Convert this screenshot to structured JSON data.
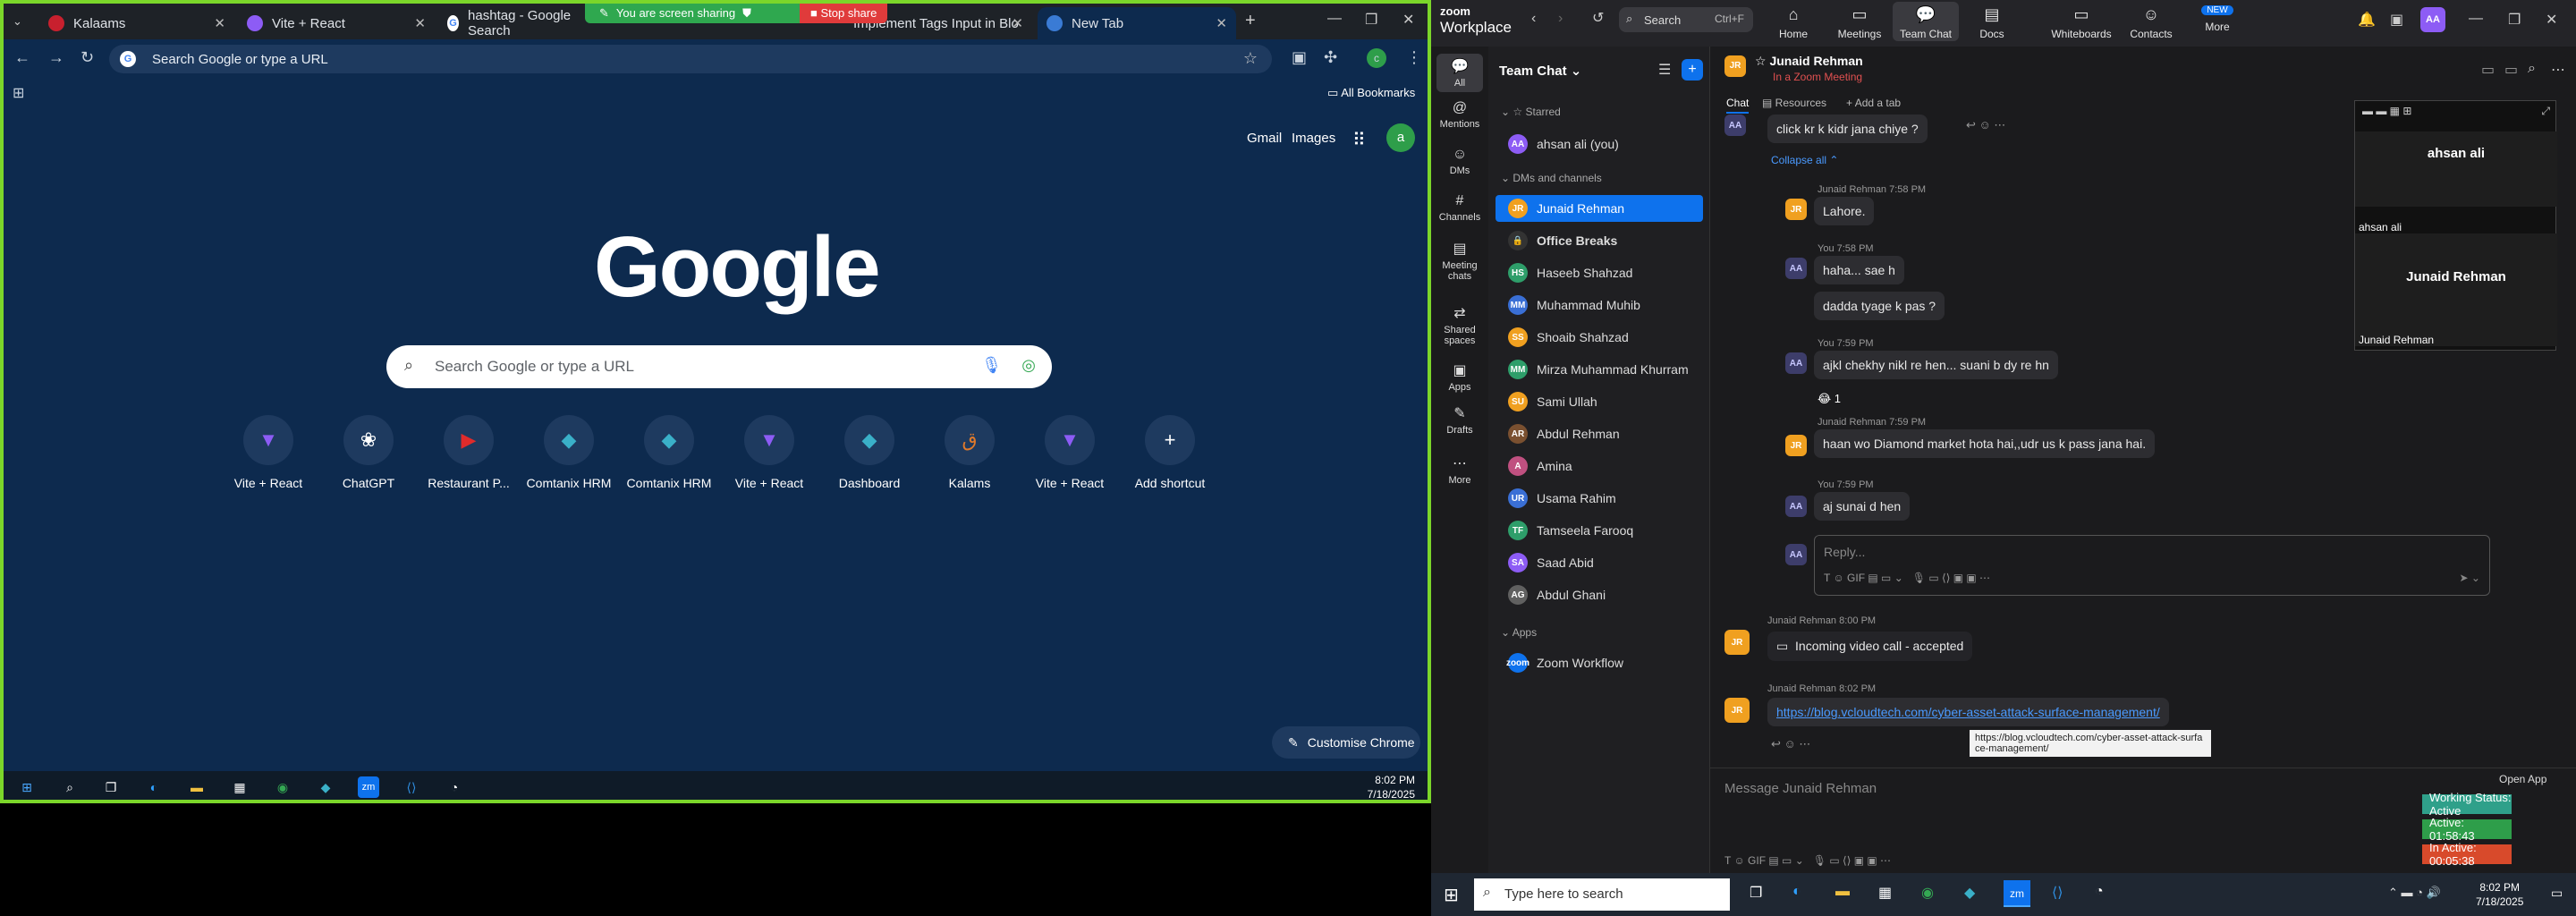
{
  "browser": {
    "tabs": [
      {
        "title": "Kalaams",
        "color": "#c8202e"
      },
      {
        "title": "Vite + React",
        "color": "#8d5cf5"
      },
      {
        "title": "hashtag - Google Search",
        "color": "#ffffff"
      },
      {
        "title": "Implement Tags Input in Blo",
        "color": "#3ad6a6"
      },
      {
        "title": "New Tab",
        "color": "#3a7bd5"
      }
    ],
    "share_banner": {
      "sharing": "You are screen sharing",
      "stop": "Stop share"
    },
    "omnibox": "Search Google or type a URL",
    "all_bookmarks": "All Bookmarks",
    "top_links": {
      "gmail": "Gmail",
      "images": "Images",
      "avatar": "a"
    },
    "logo": "Google",
    "search_placeholder": "Search Google or type a URL",
    "shortcuts": [
      {
        "label": "Vite + React",
        "icon": "▼",
        "color": "#8d5cf5"
      },
      {
        "label": "ChatGPT",
        "icon": "❀",
        "color": "#ffffff"
      },
      {
        "label": "Restaurant P...",
        "icon": "▶",
        "color": "#e02b2b"
      },
      {
        "label": "Comtanix HRM",
        "icon": "◆",
        "color": "#3ab0c8"
      },
      {
        "label": "Comtanix HRM",
        "icon": "◆",
        "color": "#3ab0c8"
      },
      {
        "label": "Vite + React",
        "icon": "▼",
        "color": "#8d5cf5"
      },
      {
        "label": "Dashboard",
        "icon": "◆",
        "color": "#3ab0c8"
      },
      {
        "label": "Kalams",
        "icon": "ق",
        "color": "#e07a2b"
      },
      {
        "label": "Vite + React",
        "icon": "▼",
        "color": "#8d5cf5"
      },
      {
        "label": "Add shortcut",
        "icon": "+",
        "color": "#ffffff"
      }
    ],
    "customise": "Customise Chrome",
    "time": "8:02 PM",
    "date": "7/18/2025"
  },
  "zoom": {
    "brand_top": "zoom",
    "brand_bottom": "Workplace",
    "search": "Search",
    "search_shortcut": "Ctrl+F",
    "nav": [
      "Home",
      "Meetings",
      "Team Chat",
      "Docs",
      "Whiteboards",
      "Contacts",
      "More"
    ],
    "new_badge": "NEW",
    "user_initials": "AA",
    "rail": [
      "All",
      "Mentions",
      "DMs",
      "Channels",
      "Meeting chats",
      "Shared spaces",
      "Apps",
      "Drafts",
      "More"
    ],
    "list_title": "Team Chat",
    "sections": {
      "starred": "Starred",
      "dms": "DMs and channels",
      "apps": "Apps"
    },
    "starred": [
      {
        "name": "ahsan ali (you)",
        "initials": "AA",
        "color": "#8d5cf5"
      }
    ],
    "contacts": [
      {
        "name": "Junaid Rehman",
        "initials": "JR",
        "color": "#f0a020"
      },
      {
        "name": "Office Breaks",
        "initials": "🔒",
        "color": "#333333"
      },
      {
        "name": "Haseeb Shahzad",
        "initials": "HS",
        "color": "#2e9e6a"
      },
      {
        "name": "Muhammad Muhib",
        "initials": "MM",
        "color": "#3a6fd5"
      },
      {
        "name": "Shoaib Shahzad",
        "initials": "SS",
        "color": "#f0a020"
      },
      {
        "name": "Mirza Muhammad Khurram",
        "initials": "MM",
        "color": "#2e9e6a"
      },
      {
        "name": "Sami Ullah",
        "initials": "SU",
        "color": "#f0a020"
      },
      {
        "name": "Abdul Rehman",
        "initials": "AR",
        "color": "#7a5030"
      },
      {
        "name": "Amina",
        "initials": "A",
        "color": "#c05080"
      },
      {
        "name": "Usama Rahim",
        "initials": "UR",
        "color": "#3a6fd5"
      },
      {
        "name": "Tamseela Farooq",
        "initials": "TF",
        "color": "#2e9e6a"
      },
      {
        "name": "Saad Abid",
        "initials": "SA",
        "color": "#8d5cf5"
      },
      {
        "name": "Abdul Ghani",
        "initials": "AG",
        "color": "#606060"
      }
    ],
    "apps": [
      {
        "name": "Zoom Workflow",
        "initials": "zoom",
        "color": "#0e72ed"
      }
    ],
    "chat_header": {
      "name": "Junaid Rehman",
      "status": "In a Zoom Meeting",
      "tabs": [
        "Chat",
        "Resources",
        "Add a tab"
      ]
    },
    "messages": {
      "m0": "click kr k kidr jana chiye ?",
      "collapse": "Collapse all",
      "m1_meta": "Junaid Rehman 7:58 PM",
      "m1": "Lahore.",
      "m2_meta": "You 7:58 PM",
      "m2a": "haha... sae h",
      "m2b": "dadda tyage k pas ?",
      "m3_meta": "You 7:59 PM",
      "m3": "ajkl chekhy nikl re hen... suani b dy re hn",
      "reaction": "😂 1",
      "m4_meta": "Junaid Rehman 7:59 PM",
      "m4": "haan wo Diamond market hota hai,,udr us k pass jana hai.",
      "m5_meta": "You 7:59 PM",
      "m5": "aj sunai d hen",
      "reply": "Reply...",
      "m6_meta": "Junaid Rehman 8:00 PM",
      "m6": "Incoming video call - accepted",
      "m7_meta": "Junaid Rehman 8:02 PM",
      "m7": "https://blog.vcloudtech.com/cyber-asset-attack-surface-management/",
      "tooltip": "https://blog.vcloudtech.com/cyber-asset-attack-surface-management/"
    },
    "composer": "Message Junaid Rehman",
    "video": {
      "p1": "ahsan ali",
      "p1_label": "ahsan ali",
      "p2": "Junaid Rehman",
      "p2_label": "Junaid Rehman"
    },
    "open_app": "Open App",
    "status": {
      "working": "Working Status: Active",
      "active": "Active: 01:58:43",
      "inactive": "In Active: 00:05:38"
    }
  },
  "taskbar": {
    "search": "Type here to search",
    "time": "8:02 PM",
    "date": "7/18/2025"
  }
}
